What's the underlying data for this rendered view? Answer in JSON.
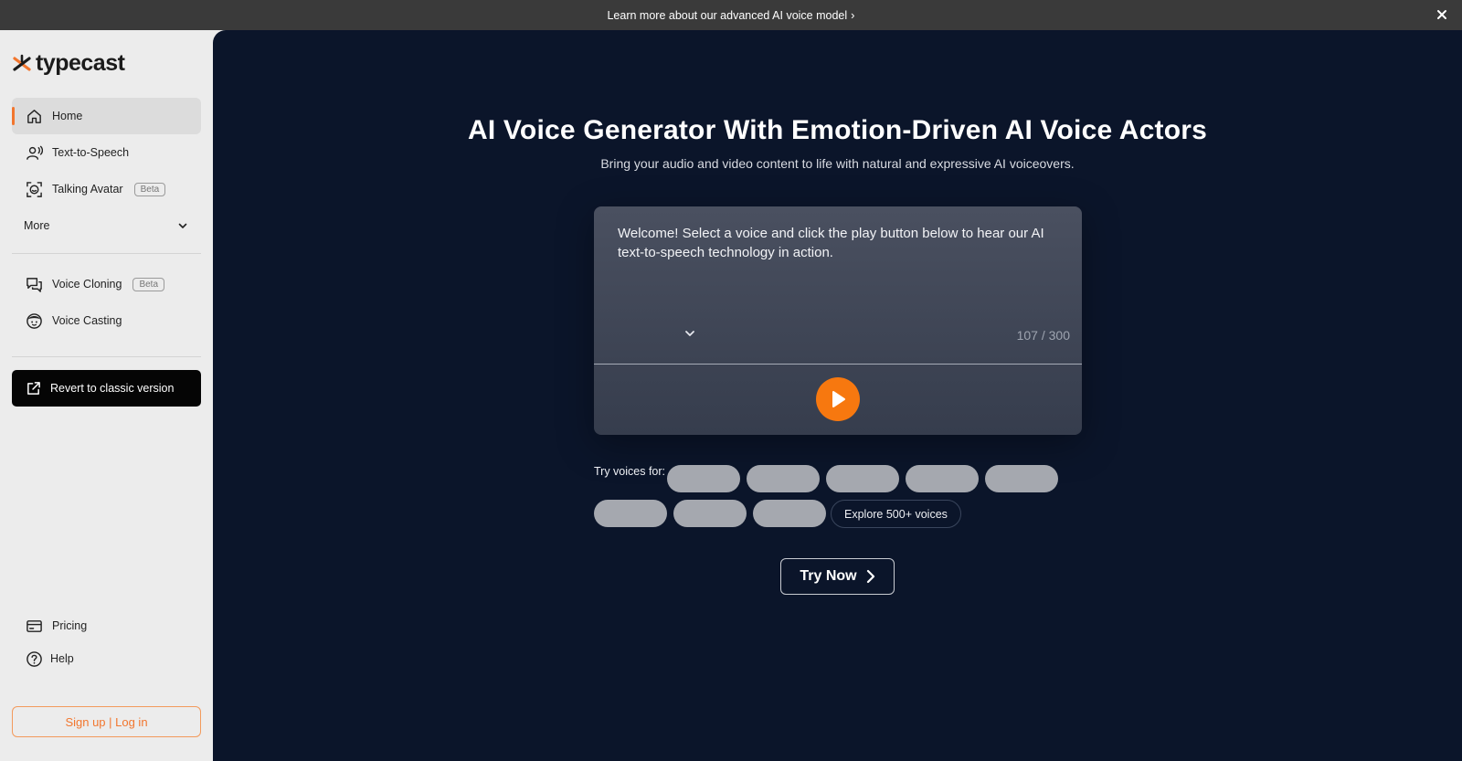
{
  "banner": {
    "text": "Learn more about our advanced AI voice model",
    "chevron": "›",
    "close_icon": "close-icon"
  },
  "sidebar": {
    "logo_text": "typecast",
    "nav_primary": [
      {
        "label": "Home",
        "icon": "home-icon",
        "active": true
      },
      {
        "label": "Text-to-Speech",
        "icon": "person-voice-icon"
      },
      {
        "label": "Talking Avatar",
        "icon": "avatar-frame-icon",
        "badge": "Beta"
      },
      {
        "label": "More",
        "icon": "chevron-down-icon"
      }
    ],
    "nav_secondary": [
      {
        "label": "Voice Cloning",
        "icon": "chat-bubbles-icon",
        "badge": "Beta"
      },
      {
        "label": "Voice Casting",
        "icon": "face-icon"
      }
    ],
    "revert_label": "Revert to classic version",
    "bottom": [
      {
        "label": "Pricing",
        "icon": "credit-card-icon"
      },
      {
        "label": "Help",
        "icon": "help-circle-icon"
      }
    ],
    "signup_label": "Sign up | Log in"
  },
  "hero": {
    "title": "AI Voice Generator With Emotion-Driven AI Voice Actors",
    "subtitle": "Bring your audio and video content to life with natural and expressive AI voiceovers."
  },
  "editor": {
    "text": "Welcome! Select a voice and click the play button below to hear our AI text-to-speech technology in action.",
    "counter": "107 / 300"
  },
  "try_voices": {
    "label": "Try voices for:",
    "explore_label": "Explore 500+ voices"
  },
  "cta": {
    "try_now": "Try Now"
  },
  "colors": {
    "accent": "#f7780f",
    "main_bg": "#0b152a",
    "sidebar_bg": "#ececec",
    "banner_bg": "#3a3a3a"
  }
}
